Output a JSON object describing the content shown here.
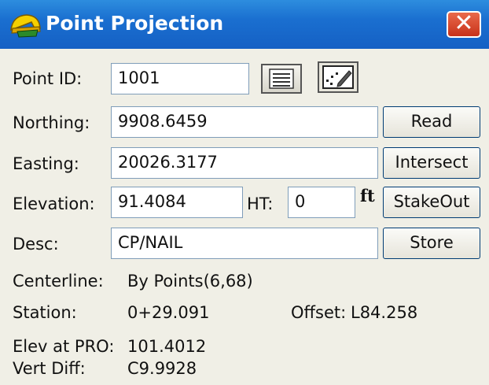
{
  "window": {
    "title": "Point Projection",
    "close_label": "✕"
  },
  "fields": {
    "point_id": {
      "label": "Point ID:",
      "value": "1001"
    },
    "northing": {
      "label": "Northing:",
      "value": "9908.6459"
    },
    "easting": {
      "label": "Easting:",
      "value": "20026.3177"
    },
    "elevation": {
      "label": "Elevation:",
      "value": "91.4084"
    },
    "ht": {
      "label": "HT:",
      "value": "0",
      "unit": "ft"
    },
    "desc": {
      "label": "Desc:",
      "value": "CP/NAIL"
    }
  },
  "buttons": {
    "read": "Read",
    "intersect": "Intersect",
    "stakeout": "StakeOut",
    "store": "Store"
  },
  "icons": {
    "list": "list-icon",
    "map": "map-icon",
    "app": "helmet-icon"
  },
  "info": {
    "centerline_label": "Centerline:",
    "centerline_value": "By Points(6,68)",
    "station_label": "Station:",
    "station_value": "0+29.091",
    "offset_label": "Offset:",
    "offset_value": "L84.258",
    "elev_pro_label": "Elev at PRO:",
    "elev_pro_value": "101.4012",
    "vert_diff_label": "Vert Diff:",
    "vert_diff_value": "C9.9928"
  }
}
